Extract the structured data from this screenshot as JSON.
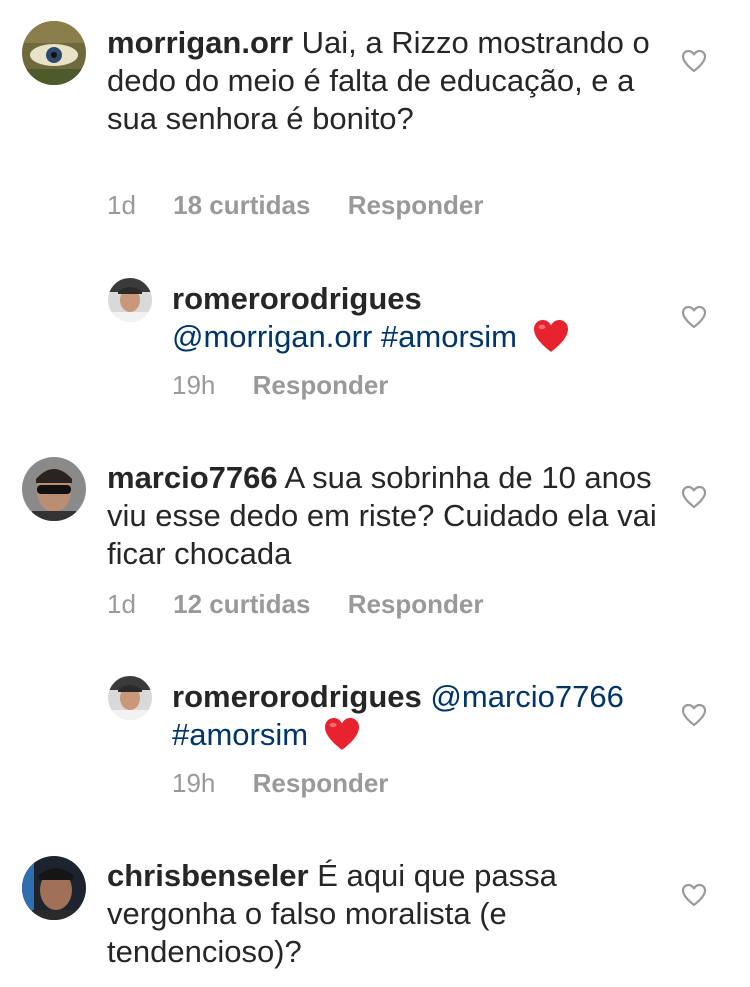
{
  "comments": [
    {
      "username": "morrigan.orr",
      "text": "Uai, a Rizzo mostrando o dedo do meio é falta de educação, e a sua senhora é bonito?",
      "time": "1d",
      "likes": "18 curtidas",
      "reply": "Responder"
    },
    {
      "username": "romerorodrigues",
      "mention": "@morrigan.orr",
      "hashtag": "#amorsim",
      "emoji": "red-heart",
      "time": "19h",
      "reply": "Responder"
    },
    {
      "username": "marcio7766",
      "text": "A sua sobrinha de 10 anos viu esse dedo em riste? Cuidado ela vai ficar chocada",
      "time": "1d",
      "likes": "12 curtidas",
      "reply": "Responder"
    },
    {
      "username": "romerorodrigues",
      "mention": "@marcio7766",
      "hashtag": "#amorsim",
      "emoji": "red-heart",
      "time": "19h",
      "reply": "Responder"
    },
    {
      "username": "chrisbenseler",
      "text": "É aqui que passa vergonha o falso moralista (e tendencioso)?"
    }
  ],
  "colors": {
    "text": "#262626",
    "secondary": "#999999",
    "link": "#003569",
    "heart_emoji": "#e8222e"
  },
  "icons": {
    "like": "heart-outline-icon",
    "emoji": "red-heart"
  }
}
